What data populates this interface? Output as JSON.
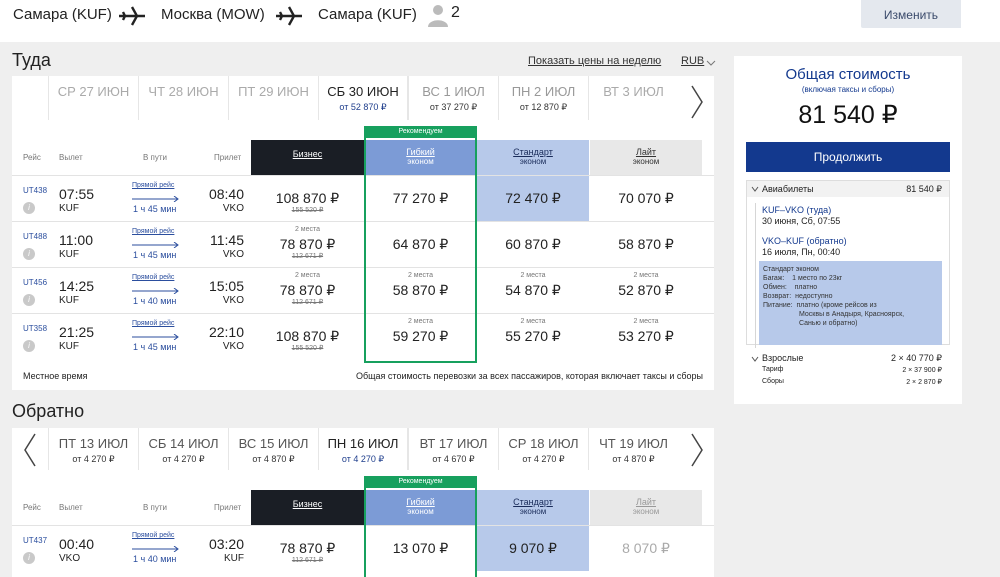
{
  "header": {
    "route": [
      "Самара (KUF)",
      "Москва (MOW)",
      "Самара (KUF)"
    ],
    "passengers": "2",
    "change_label": "Изменить"
  },
  "outbound": {
    "title": "Туда",
    "week_prices_link": "Показать цены на неделю",
    "currency": "RUB",
    "dates": [
      {
        "label": "СР 27 ИЮН",
        "price": ""
      },
      {
        "label": "ЧТ 28 ИЮН",
        "price": ""
      },
      {
        "label": "ПТ 29 ИЮН",
        "price": ""
      },
      {
        "label": "СБ 30 ИЮН",
        "price": "от 52 870 ₽"
      },
      {
        "label": "ВС 1 ИЮЛ",
        "price": "от 37 270 ₽"
      },
      {
        "label": "ПН 2 ИЮЛ",
        "price": "от 12 870 ₽"
      },
      {
        "label": "ВТ 3 ИЮЛ",
        "price": ""
      }
    ],
    "flights": [
      {
        "num": "UT438",
        "dep": "07:55",
        "from": "KUF",
        "nonstop": "Прямой рейс",
        "dur": "1 ч 45 мин",
        "arr": "08:40",
        "to": "VKO",
        "biz_seats": "",
        "biz": "108 870 ₽",
        "biz_old": "155 520 ₽",
        "flex_seats": "",
        "flex": "77 270 ₽",
        "std_seats": "",
        "std": "72 470 ₽",
        "lite_seats": "",
        "lite": "70 070 ₽"
      },
      {
        "num": "UT488",
        "dep": "11:00",
        "from": "KUF",
        "nonstop": "Прямой рейс",
        "dur": "1 ч 45 мин",
        "arr": "11:45",
        "to": "VKO",
        "biz_seats": "2 места",
        "biz": "78 870 ₽",
        "biz_old": "112 671 ₽",
        "flex_seats": "",
        "flex": "64 870 ₽",
        "std_seats": "",
        "std": "60 870 ₽",
        "lite_seats": "",
        "lite": "58 870 ₽"
      },
      {
        "num": "UT456",
        "dep": "14:25",
        "from": "KUF",
        "nonstop": "Прямой рейс",
        "dur": "1 ч 40 мин",
        "arr": "15:05",
        "to": "VKO",
        "biz_seats": "2 места",
        "biz": "78 870 ₽",
        "biz_old": "112 671 ₽",
        "flex_seats": "2 места",
        "flex": "58 870 ₽",
        "std_seats": "2 места",
        "std": "54 870 ₽",
        "lite_seats": "2 места",
        "lite": "52 870 ₽"
      },
      {
        "num": "UT358",
        "dep": "21:25",
        "from": "KUF",
        "nonstop": "Прямой рейс",
        "dur": "1 ч 45 мин",
        "arr": "22:10",
        "to": "VKO",
        "biz_seats": "",
        "biz": "108 870 ₽",
        "biz_old": "155 520 ₽",
        "flex_seats": "2 места",
        "flex": "59 270 ₽",
        "std_seats": "2 места",
        "std": "55 270 ₽",
        "lite_seats": "2 места",
        "lite": "53 270 ₽"
      }
    ],
    "local_time": "Местное время",
    "total_note": "Общая стоимость перевозки за всех пассажиров, которая включает таксы и сборы"
  },
  "columns": {
    "flight": "Рейс",
    "departure": "Вылет",
    "in_flight": "В пути",
    "arrival": "Прилет",
    "recommend": "Рекомендуем",
    "business": "Бизнес",
    "flex": "Гибкий",
    "flex_sub": "эконом",
    "standard": "Стандарт",
    "standard_sub": "эконом",
    "lite": "Лайт",
    "lite_sub": "эконом"
  },
  "return": {
    "title": "Обратно",
    "dates": [
      {
        "label": "ПТ 13 ИЮЛ",
        "price": "от 4 270 ₽"
      },
      {
        "label": "СБ 14 ИЮЛ",
        "price": "от 4 270 ₽"
      },
      {
        "label": "ВС 15 ИЮЛ",
        "price": "от 4 870 ₽"
      },
      {
        "label": "ПН 16 ИЮЛ",
        "price": "от 4 270 ₽"
      },
      {
        "label": "ВТ 17 ИЮЛ",
        "price": "от 4 670 ₽"
      },
      {
        "label": "СР 18 ИЮЛ",
        "price": "от 4 270 ₽"
      },
      {
        "label": "ЧТ 19 ИЮЛ",
        "price": "от 4 870 ₽"
      }
    ],
    "flights": [
      {
        "num": "UT437",
        "dep": "00:40",
        "from": "VKO",
        "nonstop": "Прямой рейс",
        "dur": "1 ч 40 мин",
        "arr": "03:20",
        "to": "KUF",
        "biz_seats": "",
        "biz": "78 870 ₽",
        "biz_old": "112 671 ₽",
        "flex": "13 070 ₽",
        "std": "9 070 ₽",
        "lite": "8 070 ₽"
      }
    ]
  },
  "summary": {
    "title": "Общая стоимость",
    "subtitle": "(включая таксы и сборы)",
    "total": "81 540 ₽",
    "continue": "Продолжить",
    "tickets_label": "Авиабилеты",
    "tickets_total": "81 540 ₽",
    "leg1_route": "KUF–VKO (туда)",
    "leg1_time": "30 июня, Сб, 07:55",
    "leg2_route": "VKO–KUF (обратно)",
    "leg2_time": "16 июля, Пн, 00:40",
    "fare_lines": [
      "Стандарт эконом",
      "Багаж:    1 место по 23кг",
      "Обмен:    платно",
      "Возврат:  недоступно",
      "Питание:  платно (кроме рейсов из",
      "Москвы в Анадыря, Красноярск,",
      "Санью и обратно)"
    ],
    "adults_label": "Взрослые",
    "adults_total": "2 × 40 770 ₽",
    "tariff_label": "Тариф",
    "tariff_value": "2 × 37 900 ₽",
    "fees_label": "Сборы",
    "fees_value": "2 × 2 870 ₽"
  },
  "colors": {
    "accent": "#13398e",
    "recommend": "#17a05e",
    "flex_header": "#7c9bd6",
    "std_header": "#b7c9ea",
    "lite_header": "#e8e8e8",
    "business_header": "#1a1e25"
  }
}
